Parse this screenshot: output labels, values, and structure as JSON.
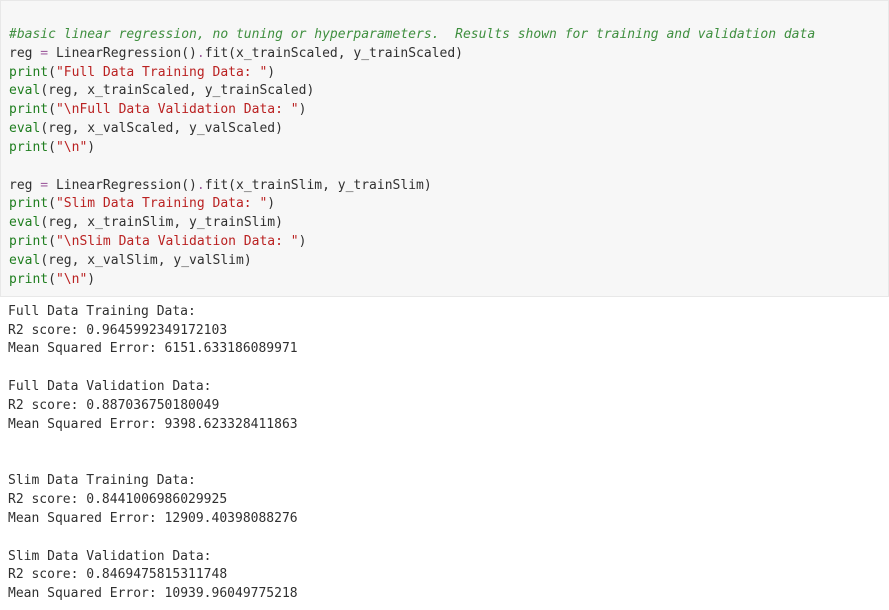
{
  "code": {
    "comment": "basic linear regression, no tuning or hyperparameters.  Results shown for training and validation data",
    "fit1": {
      "assign_target": "reg",
      "call": "LinearRegression",
      "method": "fit",
      "arg1": "x_trainScaled",
      "arg2": "y_trainScaled"
    },
    "print_full_train": "\"Full Data Training Data: \"",
    "eval_full_train": {
      "fn": "eval",
      "a1": "reg",
      "a2": "x_trainScaled",
      "a3": "y_trainScaled"
    },
    "print_full_val": "\"\\nFull Data Validation Data: \"",
    "eval_full_val": {
      "fn": "eval",
      "a1": "reg",
      "a2": "x_valScaled",
      "a3": "y_valScaled"
    },
    "print_nl1": "\"\\n\"",
    "fit2": {
      "assign_target": "reg",
      "call": "LinearRegression",
      "method": "fit",
      "arg1": "x_trainSlim",
      "arg2": "y_trainSlim"
    },
    "print_slim_train": "\"Slim Data Training Data: \"",
    "eval_slim_train": {
      "fn": "eval",
      "a1": "reg",
      "a2": "x_trainSlim",
      "a3": "y_trainSlim"
    },
    "print_slim_val": "\"\\nSlim Data Validation Data: \"",
    "eval_slim_val": {
      "fn": "eval",
      "a1": "reg",
      "a2": "x_valSlim",
      "a3": "y_valSlim"
    },
    "print_nl2": "\"\\n\"",
    "kw_print": "print",
    "kw_eval": "eval",
    "eq": " = ",
    "dot": ".",
    "lp": "(",
    "rp": ")",
    "comma": ", ",
    "hash": "#"
  },
  "output": {
    "sections": [
      {
        "title": "Full Data Training Data: ",
        "r2_label": "R2 score: ",
        "r2": "0.9645992349172103",
        "mse_label": "Mean Squared Error: ",
        "mse": "6151.633186089971"
      },
      {
        "title": "Full Data Validation Data: ",
        "r2_label": "R2 score: ",
        "r2": "0.887036750180049",
        "mse_label": "Mean Squared Error: ",
        "mse": "9398.623328411863"
      },
      {
        "title": "Slim Data Training Data: ",
        "r2_label": "R2 score: ",
        "r2": "0.8441006986029925",
        "mse_label": "Mean Squared Error: ",
        "mse": "12909.40398088276"
      },
      {
        "title": "Slim Data Validation Data: ",
        "r2_label": "R2 score: ",
        "r2": "0.8469475815311748",
        "mse_label": "Mean Squared Error: ",
        "mse": "10939.96049775218"
      }
    ]
  }
}
